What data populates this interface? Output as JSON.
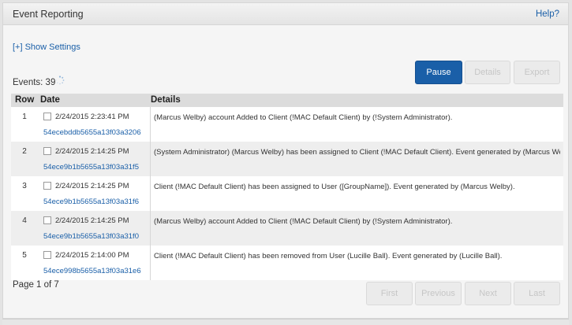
{
  "header": {
    "title": "Event Reporting",
    "help_label": "Help?"
  },
  "settings_toggle": "[+] Show Settings",
  "events_count_label": "Events: 39",
  "toolbar": {
    "pause": "Pause",
    "details": "Details",
    "export": "Export"
  },
  "table": {
    "columns": {
      "row": "Row",
      "date": "Date",
      "details": "Details"
    },
    "rows": [
      {
        "row": "1",
        "date": "2/24/2015 2:23:41 PM",
        "id": "54ecebddb5655a13f03a3206",
        "details": "(Marcus Welby) account Added to Client (!MAC Default Client) by (!System Administrator)."
      },
      {
        "row": "2",
        "date": "2/24/2015 2:14:25 PM",
        "id": "54ece9b1b5655a13f03a31f5",
        "details": "(System Administrator) (Marcus Welby) has been assigned to Client (!MAC Default Client). Event generated by (Marcus Welby)."
      },
      {
        "row": "3",
        "date": "2/24/2015 2:14:25 PM",
        "id": "54ece9b1b5655a13f03a31f6",
        "details": "Client (!MAC Default Client) has been assigned to User ([GroupName]). Event generated by (Marcus Welby)."
      },
      {
        "row": "4",
        "date": "2/24/2015 2:14:25 PM",
        "id": "54ece9b1b5655a13f03a31f0",
        "details": "(Marcus Welby) account Added to Client (!MAC Default Client) by (!System Administrator)."
      },
      {
        "row": "5",
        "date": "2/24/2015 2:14:00 PM",
        "id": "54ece998b5655a13f03a31e6",
        "details": "Client (!MAC Default Client) has been removed from User (Lucille Ball). Event generated by (Lucille Ball)."
      }
    ]
  },
  "pagination": {
    "info": "Page 1 of 7",
    "first": "First",
    "previous": "Previous",
    "next": "Next",
    "last": "Last"
  },
  "colors": {
    "accent": "#1a5fa8",
    "header_bg": "#dcdcdc",
    "row_alt": "#eeeeee"
  }
}
